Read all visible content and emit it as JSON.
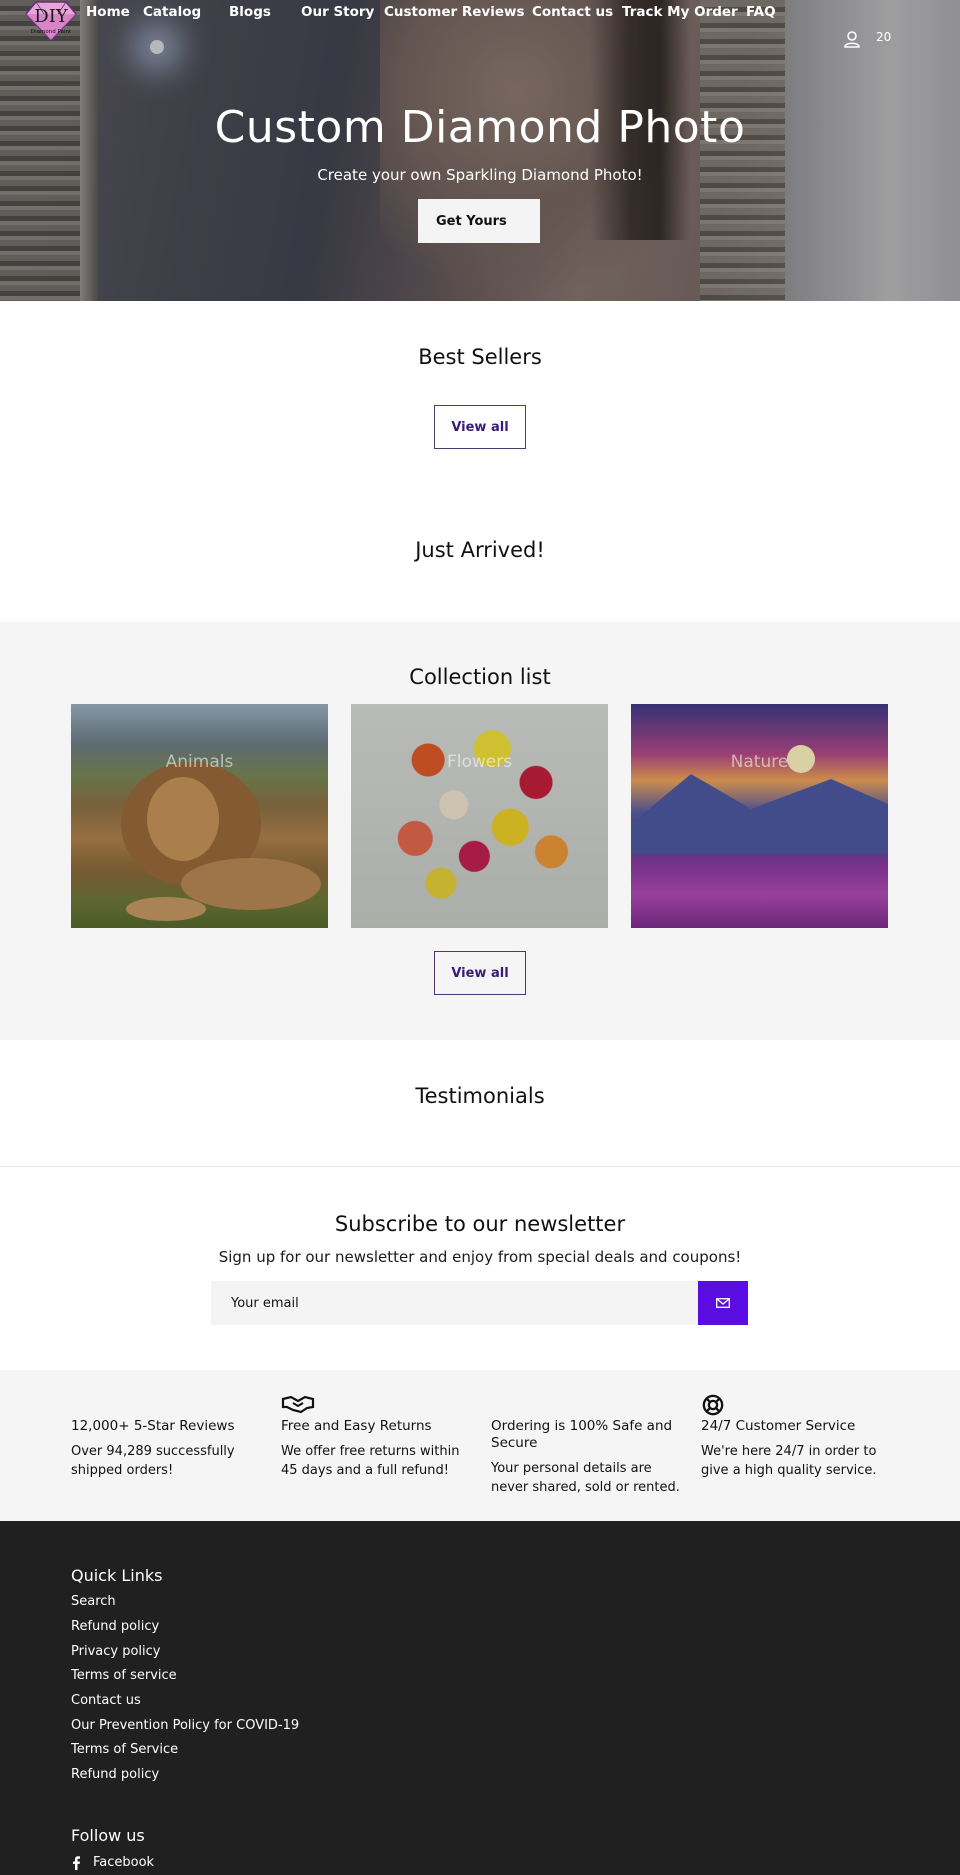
{
  "header": {
    "logo_text": "DIY",
    "logo_subtext": "Diamond Paint",
    "nav": [
      "Home",
      "Catalog",
      "Blogs",
      "Our Story",
      "Customer Reviews",
      "Contact us",
      "Track My Order",
      "FAQ"
    ],
    "cart_count": "20"
  },
  "hero": {
    "title": "Custom Diamond Photo",
    "subtitle": "Create your own Sparkling Diamond Photo!",
    "cta": "Get Yours"
  },
  "best_sellers": {
    "title": "Best Sellers",
    "view_all": "View all"
  },
  "just_arrived": {
    "title": "Just Arrived!"
  },
  "collection": {
    "title": "Collection list",
    "items": [
      "Animals",
      "Flowers",
      "Nature"
    ],
    "view_all": "View all"
  },
  "testimonials": {
    "title": "Testimonials"
  },
  "newsletter": {
    "title": "Subscribe to our newsletter",
    "subtitle": "Sign up for our newsletter and enjoy from special deals and coupons!",
    "placeholder": "Your email"
  },
  "features": [
    {
      "title": "12,000+ 5-Star Reviews",
      "desc": "Over 94,289 successfully shipped orders!",
      "icon": "none"
    },
    {
      "title": "Free and Easy Returns",
      "desc": "We offer free returns within 45 days and a full refund!",
      "icon": "handshake-icon"
    },
    {
      "title": "Ordering is 100% Safe and Secure",
      "desc": "Your personal details are never shared, sold or rented.",
      "icon": "none"
    },
    {
      "title": "24/7 Customer Service",
      "desc": "We're here 24/7 in order to give a high quality service.",
      "icon": "lifebuoy-icon"
    }
  ],
  "footer": {
    "quick_links_title": "Quick Links",
    "links": [
      "Search",
      "Refund policy",
      "Privacy policy",
      "Terms of service",
      "Contact us",
      "Our Prevention Policy for COVID-19",
      "Terms of Service",
      "Refund policy"
    ],
    "follow_title": "Follow us",
    "social": "Facebook"
  },
  "colors": {
    "accent": "#5a0de0",
    "footer_bg": "#202020",
    "section_bg": "#f5f5f5"
  }
}
